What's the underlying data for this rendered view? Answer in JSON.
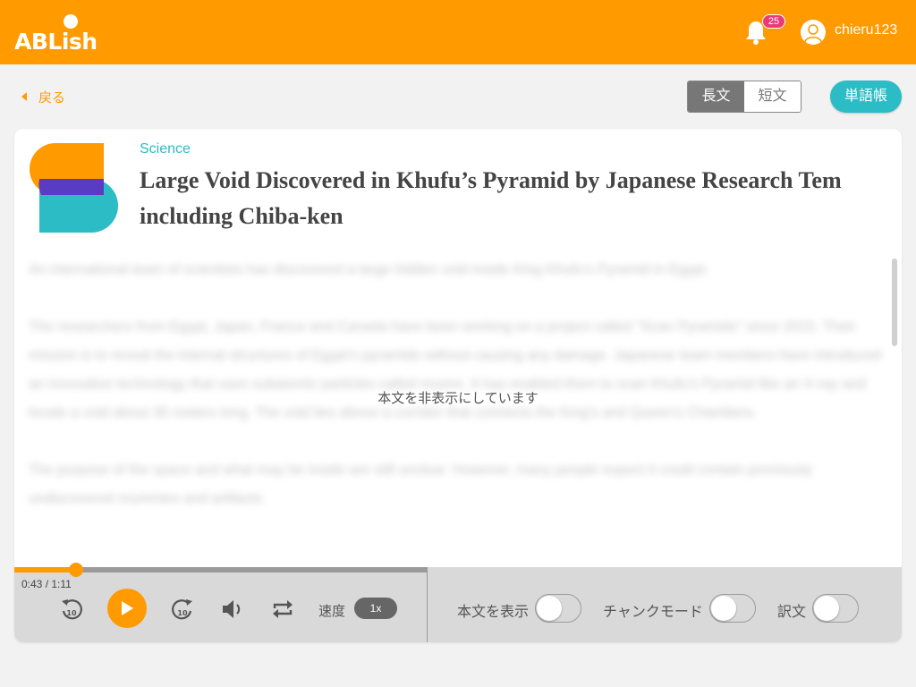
{
  "header": {
    "logo_text": "ABLish",
    "notifications_count": "25",
    "username": "chieru123",
    "brand_color": "#ff9a00"
  },
  "nav": {
    "back_label": "戻る",
    "segment": {
      "long_label": "長文",
      "short_label": "短文",
      "selected": "長文"
    },
    "vocab_label": "単語帳"
  },
  "article": {
    "category": "Science",
    "title": "Large Void Discovered in Khufu’s Pyramid by Japanese Research Tem including Chiba-ken",
    "paragraphs": [
      "An international team of scientists has discovered a large hidden void inside King Khufu's Pyramid in Egypt.",
      "The researchers from Egypt, Japan, France and Canada have been working on a project called \"Scan Pyramids\" since 2015. Their mission is to reveal the internal structures of Egypt's pyramids without causing any damage. Japanese team members have introduced an innovative technology that uses subatomic particles called muons. It has enabled them to scan Khufu's Pyramid like an X-ray and locate a void about 30 meters long. The void lies above a corridor that connects the King's and Queen's Chambers.",
      "The purpose of the space and what may be inside are still unclear. However, many people expect it could contain previously undiscovered mummies and artifacts."
    ],
    "hidden_message": "本文を非表示にしています"
  },
  "player": {
    "time_text": "0:43 / 1:11",
    "progress_fraction": 0.15,
    "speed_label": "速度",
    "speed_value": "1x",
    "skip_back_label": "10",
    "skip_forward_label": "10",
    "toggles": [
      {
        "label": "本文を表示",
        "on": false
      },
      {
        "label": "チャンクモード",
        "on": false
      },
      {
        "label": "訳文",
        "on": false
      }
    ]
  },
  "colors": {
    "accent_teal": "#2bbcc6",
    "art_purple": "#5a3cc4"
  }
}
